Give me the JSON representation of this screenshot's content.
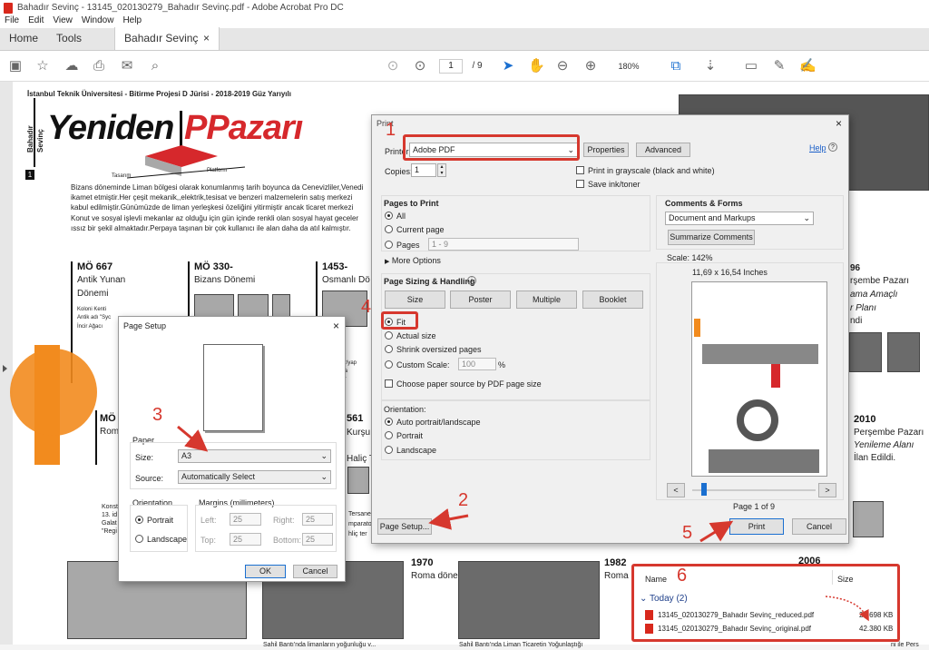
{
  "window": {
    "title": "Bahadır Sevinç - 13145_020130279_Bahadır Sevinç.pdf - Adobe Acrobat Pro DC"
  },
  "menu": [
    "File",
    "Edit",
    "View",
    "Window",
    "Help"
  ],
  "tabs": {
    "home": "Home",
    "tools": "Tools",
    "doc": "Bahadır Sevinç - 13...",
    "close": "×"
  },
  "toolbar": {
    "page_input": "1",
    "page_total": "/ 9",
    "zoom": "180%"
  },
  "document": {
    "header": "İstanbul Teknik Üniversitesi - Bitirme Projesi D Jürisi - 2018-2019 Güz Yarıyılı",
    "author_side": "Bahadır Sevinç",
    "side_num": "1",
    "logo_a": "Yeniden",
    "logo_b": "PPazarı",
    "logo_sub1": "Tasarım",
    "logo_sub2": "Platform",
    "intro": [
      "Bizans döneminde Liman bölgesi olarak konumlanmış tarih boyunca da Cenevizliler,Venedi",
      "ikamet etmiştir.Her çeşit mekanik,,elektrik,tesisat ve benzeri malzemelerin satış merkezi",
      "kabul edilmiştir.Günümüzde de liman yerleşkesi özeliğini yitirmiştir ancak ticaret merkezi",
      "Konut ve sosyal işlevli mekanlar az olduğu için gün içinde renkli olan sosyal hayat geceler",
      "ıssız bir şekil almaktadır.Perpaya taşınan bir çok  kullanıcı  ile alan daha da atıl kalmıştır."
    ],
    "t1_year": "MÖ 667",
    "t1_l1": "Antik Yunan",
    "t1_l2": "Dönemi",
    "t1_s1": "Koloni Kenti",
    "t1_s2": "Antik adı \"Syc",
    "t1_s3": "İncir Ağacı",
    "t2_year": "MÖ 330-",
    "t2_l1": "Bizans Dönemi",
    "t3_year": "1453-",
    "t3_l1": "Osmanlı Dö",
    "t3_s1": "ğılar/yap",
    "t3_s2": "alata",
    "t3_s3": "ezar",
    "r1_year": "96",
    "r1_l1": "rşembe Pazarı",
    "r1_l2": "ama Amaçlı",
    "r1_l3": "r Planı",
    "r1_l4": "ndi",
    "mo_a": "MÖ",
    "mo_b": "Rom",
    "y561": "561",
    "kursu": "Kurşu",
    "haliç": "Haliç T",
    "y2010": "2010",
    "r2_l1": "Perşembe Pazarı",
    "r2_l2": "Yenileme Alanı",
    "r2_l3": "İlan Edildi.",
    "b_konst": [
      "Konst",
      "13. id",
      "Galat",
      "\"Regi"
    ],
    "b_tersane": [
      "Tersane-",
      "mparato",
      "hliç ter"
    ],
    "y1970": "1970",
    "roma1": "Roma dönemi",
    "y1982": "1982",
    "roma2": "Roma",
    "y2006": "2006",
    "cap1": "Sahil Bantı'nda limanların yoğunluğu v...",
    "cap2": "Sahil Bantı'nda Liman Ticaretin Yoğunlaştığı",
    "cap3": "ni ile Pers"
  },
  "print_dialog": {
    "title": "Print",
    "close": "×",
    "printer_label": "Printer:",
    "printer": "Adobe PDF",
    "properties": "Properties",
    "advanced": "Advanced",
    "help": "Help",
    "copies_label": "Copies:",
    "copies": "1",
    "grayscale": "Print in grayscale (black and white)",
    "save_ink": "Save ink/toner",
    "pages_to_print": "Pages to Print",
    "all": "All",
    "current_page": "Current page",
    "pages": "Pages",
    "pages_range": "1 - 9",
    "more_options": "More Options",
    "sizing_title": "Page Sizing & Handling",
    "size": "Size",
    "poster": "Poster",
    "multiple": "Multiple",
    "booklet": "Booklet",
    "fit": "Fit",
    "actual_size": "Actual size",
    "shrink": "Shrink oversized pages",
    "custom_scale": "Custom Scale:",
    "custom_value": "100",
    "percent": "%",
    "choose_source": "Choose paper source by PDF page size",
    "orientation": "Orientation:",
    "auto_portrait": "Auto portrait/landscape",
    "portrait": "Portrait",
    "landscape": "Landscape",
    "comments_title": "Comments & Forms",
    "comments_value": "Document and Markups",
    "summarize": "Summarize Comments",
    "scale": "Scale: 142%",
    "paper_size": "11,69 x 16,54 Inches",
    "page_of": "Page 1 of 9",
    "page_setup": "Page Setup...",
    "print": "Print",
    "cancel": "Cancel",
    "prev": "<",
    "next": ">"
  },
  "page_setup_dialog": {
    "title": "Page Setup",
    "close": "×",
    "paper": "Paper",
    "size_label": "Size:",
    "size_value": "A3",
    "source_label": "Source:",
    "source_value": "Automatically Select",
    "orientation": "Orientation",
    "portrait": "Portrait",
    "landscape": "Landscape",
    "margins": "Margins (millimeters)",
    "left": "Left:",
    "right": "Right:",
    "top": "Top:",
    "bottom": "Bottom:",
    "left_v": "25",
    "right_v": "25",
    "top_v": "25",
    "bottom_v": "25",
    "ok": "OK",
    "cancel": "Cancel"
  },
  "file_list": {
    "col_name": "Name",
    "col_size": "Size",
    "group": "Today (2)",
    "files": [
      {
        "name": "13145_020130279_Bahadır Sevinç_reduced.pdf",
        "size": "23.698 KB"
      },
      {
        "name": "13145_020130279_Bahadır Sevinç_original.pdf",
        "size": "42.380 KB"
      }
    ]
  },
  "annotations": [
    "1",
    "2",
    "3",
    "4",
    "5",
    "6"
  ],
  "colors": {
    "accent_red": "#d6382e",
    "orange": "#f28b1e",
    "logo_red": "#d6282c"
  }
}
